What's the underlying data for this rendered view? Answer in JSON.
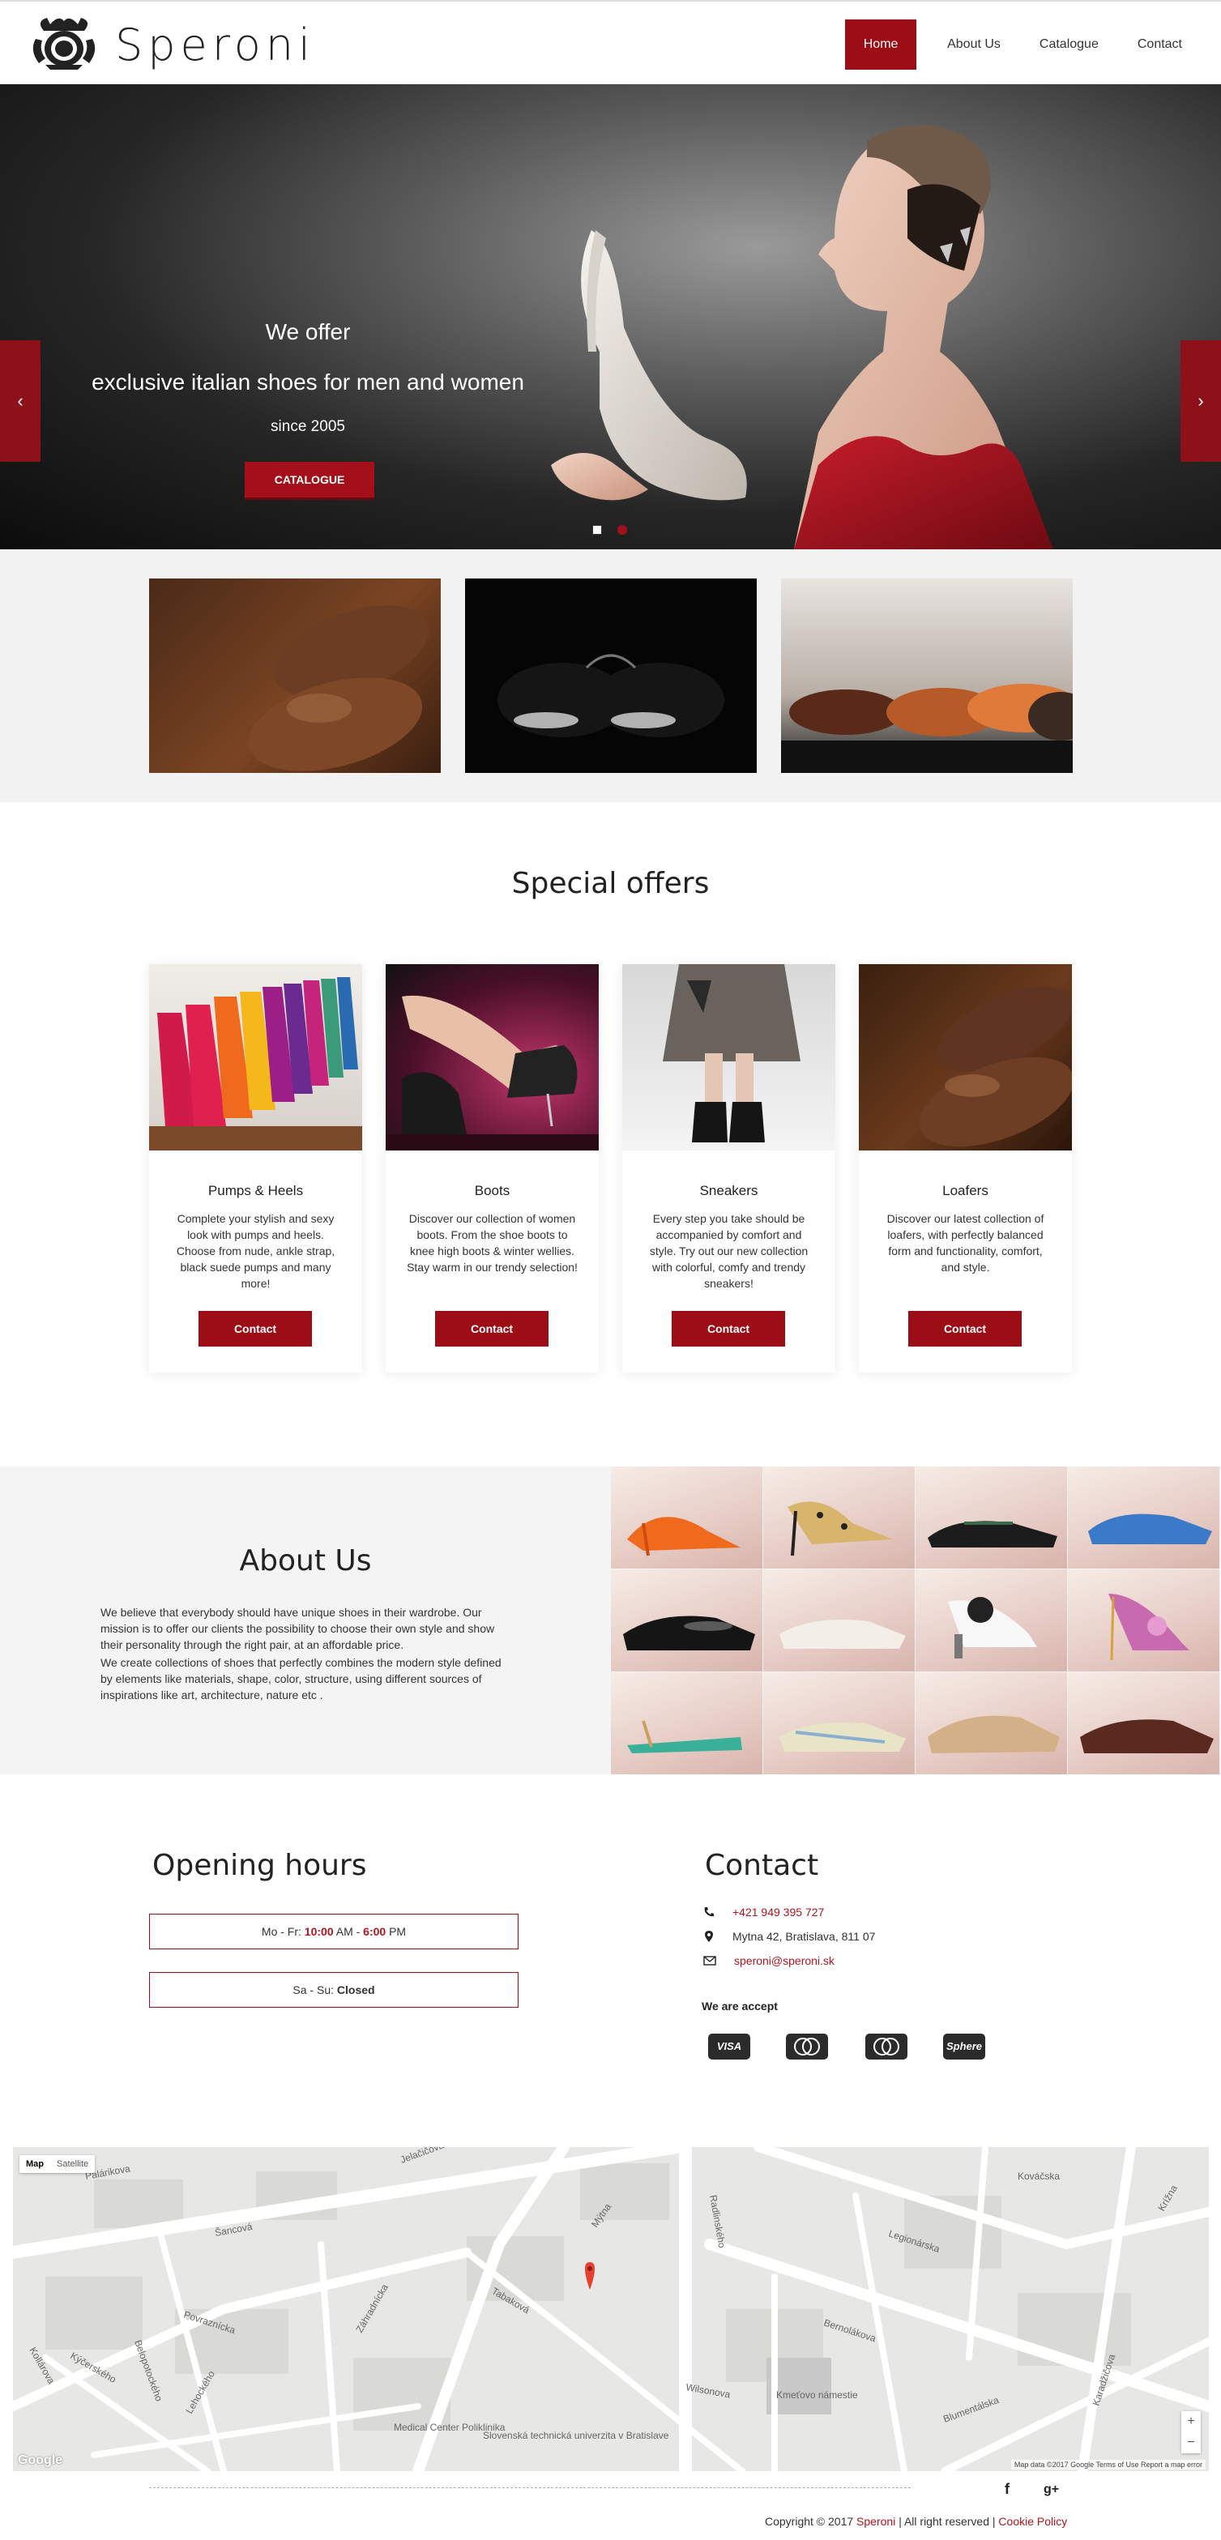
{
  "brand": {
    "name": "Speroni"
  },
  "nav": {
    "items": [
      "Home",
      "About Us",
      "Catalogue",
      "Contact"
    ]
  },
  "hero": {
    "line1": "We offer",
    "line2": "exclusive italian shoes for men and women",
    "line3": "since 2005",
    "button": "CATALOGUE",
    "prev": "‹",
    "next": "›"
  },
  "offers": {
    "title": "Special offers",
    "cards": [
      {
        "title": "Pumps & Heels",
        "text": "Complete your stylish and sexy look with pumps and heels. Choose from nude, ankle strap, black suede pumps and many more!",
        "button": "Contact"
      },
      {
        "title": "Boots",
        "text": "Discover our collection of women boots. From the shoe boots to knee high boots & winter wellies. Stay warm in our trendy selection!",
        "button": "Contact"
      },
      {
        "title": "Sneakers",
        "text": "Every step you take should be accompanied by comfort and style. Try out our new collection with colorful, comfy and trendy sneakers!",
        "button": "Contact"
      },
      {
        "title": "Loafers",
        "text": "Discover our latest collection of loafers, with perfectly balanced form and functionality, comfort, and style.",
        "button": "Contact"
      }
    ]
  },
  "about": {
    "title": "About Us",
    "p1": "We believe that everybody should have unique shoes in their wardrobe. Our mission is to offer our clients the possibility to choose their own style and show their personality through the right pair, at an affordable price.",
    "p2": " We create collections of shoes that perfectly combines the modern style defined by elements like materials, shape, color, structure, using different sources of inspirations like art, architecture, nature etc ."
  },
  "hours": {
    "title": "Opening hours",
    "weekday_label": "Mo - Fr: ",
    "weekday_open": "10:00",
    "weekday_mid": " AM - ",
    "weekday_close": "6:00",
    "weekday_end": " PM",
    "weekend_label": "Sa - Su: ",
    "weekend_value": "Closed"
  },
  "contact": {
    "title": "Contact",
    "phone": "+421 949 395 727",
    "address": "Mytna 42, Bratislava, 811 07",
    "email": "speroni@speroni.sk",
    "accept_label": "We are accept",
    "cards": [
      "VISA",
      "MC",
      "Maestro",
      "Sphere"
    ]
  },
  "map": {
    "tab_map": "Map",
    "tab_satellite": "Satellite",
    "streets": [
      "Palárikova",
      "Šancová",
      "Mýtna",
      "Legionárska",
      "Radlinského",
      "Bernolákova",
      "Wilsonova",
      "Kmeťovo námestie",
      "Karadžičova",
      "Kollárova",
      "Povraznícka",
      "Záhradnícka",
      "Tabaková",
      "Blumentálska",
      "Kýčerského",
      "Lehockého",
      "Belopotockého",
      "Medical Center Poliklinika",
      "Slovenská technická univerzita v Bratislave",
      "Krížna",
      "Kováčska",
      "Jelačičova"
    ],
    "credits": "Map data ©2017 Google   Terms of Use   Report a map error",
    "logo": "Google",
    "zoom_in": "+",
    "zoom_out": "−"
  },
  "footer": {
    "copy_prefix": "Copyright © 2017 ",
    "copy_brand": "Speroni",
    "copy_mid": " | All right reserved | ",
    "copy_cookie": "Cookie Policy",
    "fb": "f",
    "gplus": "g+"
  },
  "colors": {
    "accent": "#9c0d16",
    "text": "#333333",
    "strip_bg": "#f2f2f2"
  }
}
